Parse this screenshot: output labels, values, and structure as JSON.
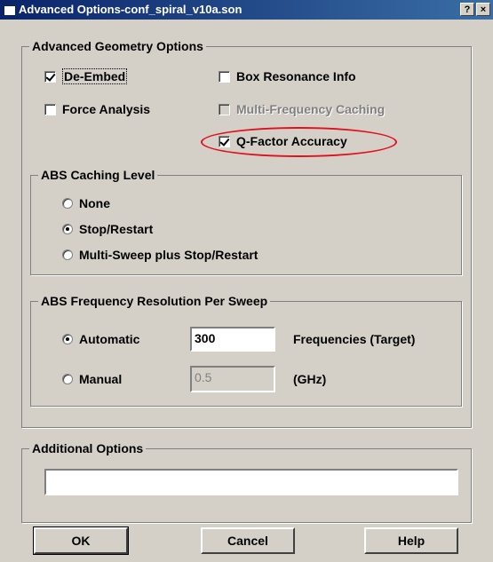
{
  "window": {
    "title": "Advanced Options-conf_spiral_v10a.son",
    "help_button": "?",
    "close_button": "×"
  },
  "geometry": {
    "legend": "Advanced Geometry Options",
    "de_embed": {
      "label": "De-Embed",
      "checked": true
    },
    "box_resonance": {
      "label": "Box Resonance Info",
      "checked": false
    },
    "force_analysis": {
      "label": "Force Analysis",
      "checked": false
    },
    "multi_freq_caching": {
      "label": "Multi-Frequency Caching",
      "checked": false,
      "enabled": false
    },
    "q_factor": {
      "label": "Q-Factor Accuracy",
      "checked": true
    }
  },
  "abs_caching": {
    "legend": "ABS Caching Level",
    "options": [
      "None",
      "Stop/Restart",
      "Multi-Sweep plus Stop/Restart"
    ],
    "selected": "Stop/Restart"
  },
  "abs_resolution": {
    "legend": "ABS Frequency Resolution Per Sweep",
    "automatic_label": "Automatic",
    "automatic_value": "300",
    "automatic_unit": "Frequencies (Target)",
    "manual_label": "Manual",
    "manual_value": "0.5",
    "manual_unit": "(GHz)",
    "selected": "Automatic"
  },
  "additional": {
    "legend": "Additional Options",
    "value": ""
  },
  "buttons": {
    "ok": "OK",
    "cancel": "Cancel",
    "help": "Help"
  },
  "colors": {
    "titlebar": "#0a246a",
    "face": "#d4d0c8",
    "highlight_ellipse": "#e0101c"
  }
}
